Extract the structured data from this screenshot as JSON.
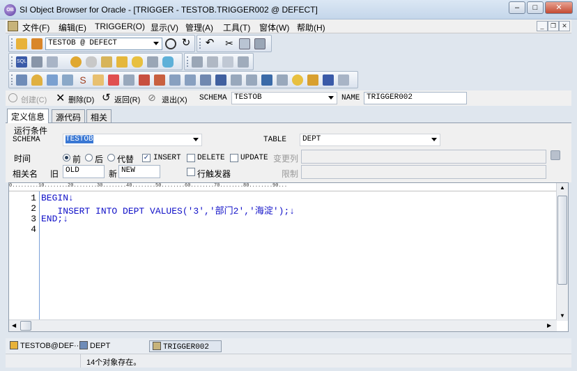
{
  "window": {
    "title": "SI Object Browser for Oracle - [TRIGGER - TESTOB.TRIGGER002 @ DEFECT]",
    "app_icon_text": "OB"
  },
  "menu": [
    "文件(F)",
    "编辑(E)",
    "TRIGGER(O)",
    "显示(V)",
    "管理(A)",
    "工具(T)",
    "窗体(W)",
    "帮助(H)"
  ],
  "toolbar": {
    "connection": "TESTOB @ DEFECT"
  },
  "actions": {
    "create": "创建(C)",
    "delete": "删除(D)",
    "back": "返回(R)",
    "exit": "退出(X)",
    "schema_label": "SCHEMA",
    "schema_value": "TESTOB",
    "name_label": "NAME",
    "name_value": "TRIGGER002"
  },
  "tabs": [
    "定义信息",
    "源代码",
    "相关"
  ],
  "form": {
    "group_title": "运行条件",
    "schema_label": "SCHEMA",
    "schema_value": "TESTOB",
    "table_label": "TABLE",
    "table_value": "DEPT",
    "timing_label": "时间",
    "timing_options": [
      "前",
      "后",
      "代替"
    ],
    "events": [
      "INSERT",
      "DELETE",
      "UPDATE"
    ],
    "change_col_label": "变更列",
    "alias_label": "相关名",
    "old_label": "旧",
    "old_value": "OLD",
    "new_label": "新",
    "new_value": "NEW",
    "row_trigger_label": "行触发器",
    "limit_label": "限制"
  },
  "editor": {
    "ruler": "0.........10........20........30........40........50........60........70........80........90...",
    "line_numbers": [
      "1",
      "2",
      "3",
      "4"
    ],
    "lines": [
      "BEGIN↓",
      "   INSERT INTO DEPT VALUES('3','部门2','海淀');↓",
      "END;↓",
      ""
    ]
  },
  "tasks": [
    "TESTOB@DEF···",
    "DEPT",
    "TRIGGER002"
  ],
  "status": {
    "message": "14个对象存在。"
  }
}
